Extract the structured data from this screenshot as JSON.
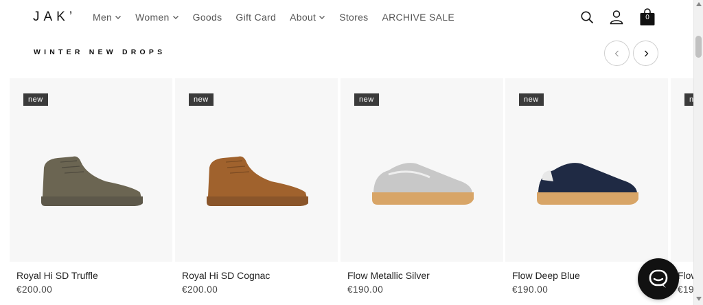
{
  "brand": {
    "logo": "JAK’"
  },
  "nav": {
    "items": [
      {
        "label": "Men",
        "has_dropdown": true
      },
      {
        "label": "Women",
        "has_dropdown": true
      },
      {
        "label": "Goods",
        "has_dropdown": false
      },
      {
        "label": "Gift Card",
        "has_dropdown": false
      },
      {
        "label": "About",
        "has_dropdown": true
      },
      {
        "label": "Stores",
        "has_dropdown": false
      },
      {
        "label": "ARCHIVE SALE",
        "has_dropdown": false
      }
    ]
  },
  "header_icons": {
    "search": "search-icon",
    "account": "user-icon",
    "cart": "shopping-bag-icon",
    "cart_count": "0"
  },
  "section": {
    "title": "WINTER NEW DROPS",
    "prev_icon": "chevron-left-icon",
    "next_icon": "chevron-right-icon"
  },
  "products": [
    {
      "badge": "new",
      "name": "Royal Hi SD Truffle",
      "price": "€200.00",
      "color": "#6b6552",
      "sole": "#5d584a",
      "style": "high"
    },
    {
      "badge": "new",
      "name": "Royal Hi SD Cognac",
      "price": "€200.00",
      "color": "#a0622d",
      "sole": "#8a552a",
      "style": "high"
    },
    {
      "badge": "new",
      "name": "Flow Metallic Silver",
      "price": "€190.00",
      "color": "#c8c8c8",
      "sole": "#d8a567",
      "style": "low"
    },
    {
      "badge": "new",
      "name": "Flow Deep Blue",
      "price": "€190.00",
      "color": "#1f2a44",
      "sole": "#d8a567",
      "style": "low"
    },
    {
      "badge": "n",
      "name": "Flow",
      "price": "€19",
      "color": "#cccccc",
      "sole": "#d8a567",
      "style": "low"
    }
  ],
  "chat": {
    "icon": "chat-bubble-icon"
  }
}
